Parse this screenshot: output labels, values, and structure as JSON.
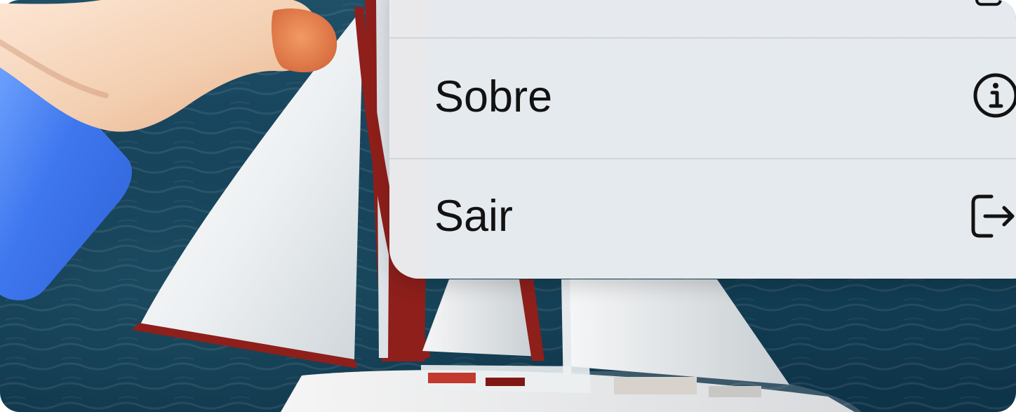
{
  "context_menu": {
    "items": [
      {
        "label": "Sobre",
        "icon": "info-circle-icon"
      },
      {
        "label": "Sair",
        "icon": "logout-icon"
      }
    ],
    "partial_top_item": {
      "icon": "partial-square-icon"
    }
  },
  "colors": {
    "menu_background": "#ECF0F4",
    "text": "#121212",
    "sea": "#143F57",
    "sail": "#EEF1F2",
    "sail_trim": "#8E1F1B",
    "hand_skin": "#F6D3B7",
    "sleeve": "#4F82F2"
  }
}
